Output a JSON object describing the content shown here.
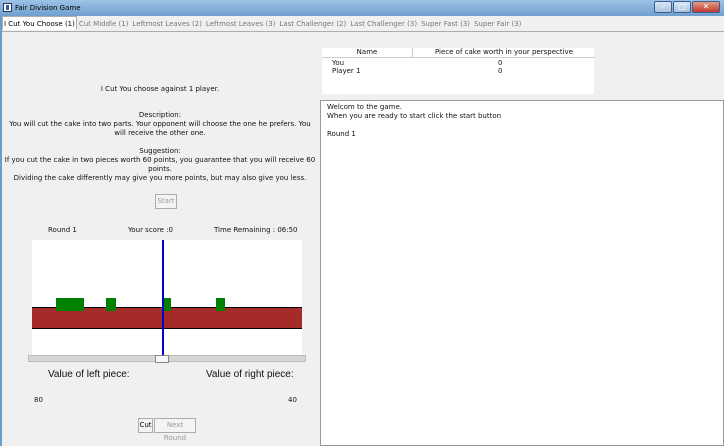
{
  "window": {
    "title": "Fair Division Game"
  },
  "tabs": [
    {
      "label": "I Cut You Choose (1)"
    },
    {
      "label": "Cut Middle (1)"
    },
    {
      "label": "Leftmost Leaves (2)"
    },
    {
      "label": "Leftmost Leaves (3)"
    },
    {
      "label": "Last Challenger (2)"
    },
    {
      "label": "Last Challenger (3)"
    },
    {
      "label": "Super Fast (3)"
    },
    {
      "label": "Super Fair (3)"
    }
  ],
  "game": {
    "heading": "I Cut You choose against 1 player.",
    "description_title": "Description:",
    "description_lines": [
      "You will cut the cake into two parts. Your opponent will choose the one he prefers. You",
      "will receive the other one."
    ],
    "suggestion_title": "Suggestion:",
    "suggestion_lines": [
      "If you cut the cake in two pieces worth 60 points, you guarantee that you will receive 60",
      "points.",
      "Dividing the cake differently may give you more points, but may also give you less."
    ],
    "start_label": "Start",
    "round_label": "Round 1",
    "score_label": "Your score :0",
    "time_label": "Time Remaining : 06:50",
    "left_value_label": "Value of left piece:",
    "right_value_label": "Value of right piece:",
    "left_value": "80",
    "right_value": "40",
    "cut_label": "Cut",
    "next_round_label": "Next Round",
    "cut_position": 0.48
  },
  "scores_table": {
    "headers": [
      "Name",
      "Piece of cake worth in your perspective"
    ],
    "rows": [
      {
        "name": "You",
        "value": "0"
      },
      {
        "name": "Player 1",
        "value": "0"
      }
    ]
  },
  "log": {
    "lines": [
      "Welcom to the game.",
      "When you are ready to start click the start button",
      "",
      "Round 1"
    ]
  },
  "colors": {
    "cake": "#a52a2a",
    "topping": "#008000",
    "cut_line": "#0000cc"
  }
}
